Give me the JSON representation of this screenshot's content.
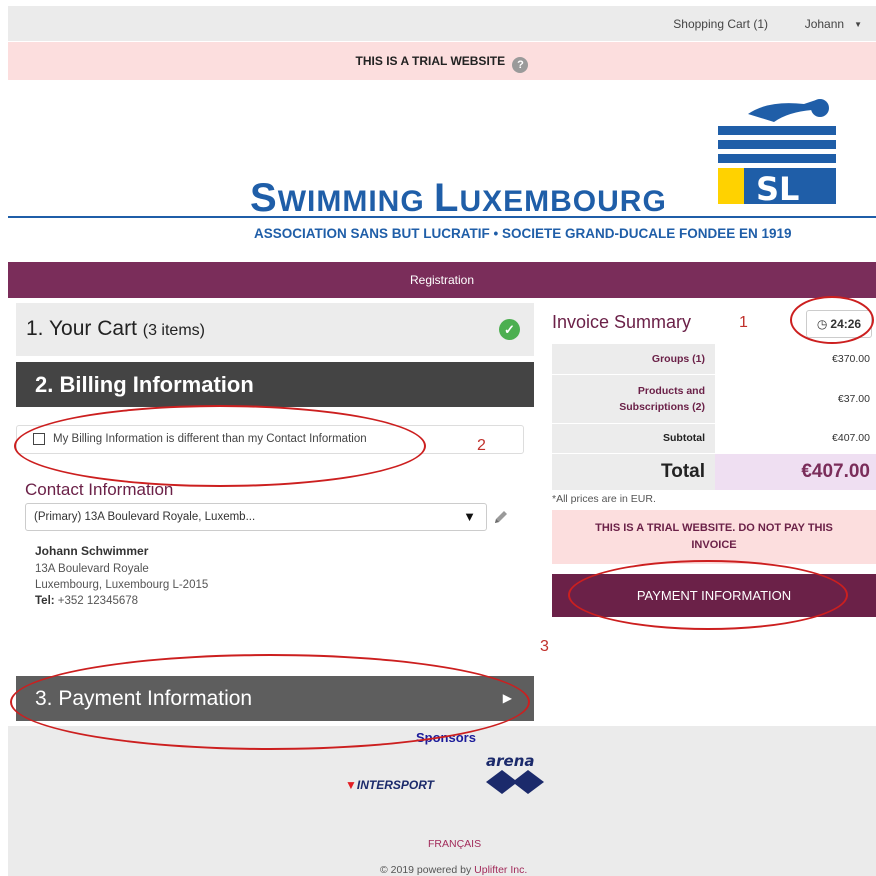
{
  "topbar": {
    "cart": "Shopping Cart (1)",
    "user": "Johann"
  },
  "trial_banner": {
    "text": "THIS IS A TRIAL WEBSITE",
    "help": "?"
  },
  "brand": {
    "title_s1": "S",
    "title_r1": "WIMMING ",
    "title_s2": "L",
    "title_r2": "UXEMBOURG",
    "subtitle": "ASSOCIATION SANS BUT LUCRATIF • SOCIETE GRAND-DUCALE FONDEE EN 1919",
    "colors": {
      "blue": "#1f5ea8",
      "yellow": "#ffd200",
      "plum": "#7a2d5a"
    }
  },
  "nav": {
    "registration": "Registration"
  },
  "steps": {
    "cart": {
      "label": "1. Your Cart",
      "count": "(3 items)"
    },
    "billing": {
      "label": "2. Billing Information"
    },
    "payment": {
      "label": "3. Payment Information"
    }
  },
  "billing": {
    "checkbox_label": "My Billing Information is different than my Contact Information",
    "contact_heading": "Contact Information",
    "address_select": "(Primary) 13A Boulevard Royale, Luxemb...",
    "contact": {
      "name": "Johann Schwimmer",
      "line1": "13A Boulevard Royale",
      "line2": "Luxembourg, Luxembourg L-2015",
      "tel_label": "Tel:",
      "tel": "+352 12345678"
    }
  },
  "invoice": {
    "title": "Invoice Summary",
    "timer": "24:26",
    "rows": [
      {
        "label": "Groups (1)",
        "value": "€370.00"
      },
      {
        "label_line1": "Products and",
        "label_line2": "Subscriptions (2)",
        "value": "€37.00"
      },
      {
        "label": "Subtotal",
        "value": "€407.00"
      },
      {
        "label": "Total",
        "value": "€407.00"
      }
    ],
    "note": "*All prices are in EUR.",
    "warning": "THIS IS A TRIAL WEBSITE. DO NOT PAY THIS INVOICE",
    "pay_button": "PAYMENT INFORMATION"
  },
  "footer": {
    "sponsors": "Sponsors",
    "intersport": "INTERSPORT",
    "arena": "arena",
    "language": "FRANÇAIS",
    "copyright": "© 2019 powered by ",
    "powered_link": "Uplifter Inc."
  },
  "annotations": {
    "n1": "1",
    "n2": "2",
    "n3": "3"
  }
}
